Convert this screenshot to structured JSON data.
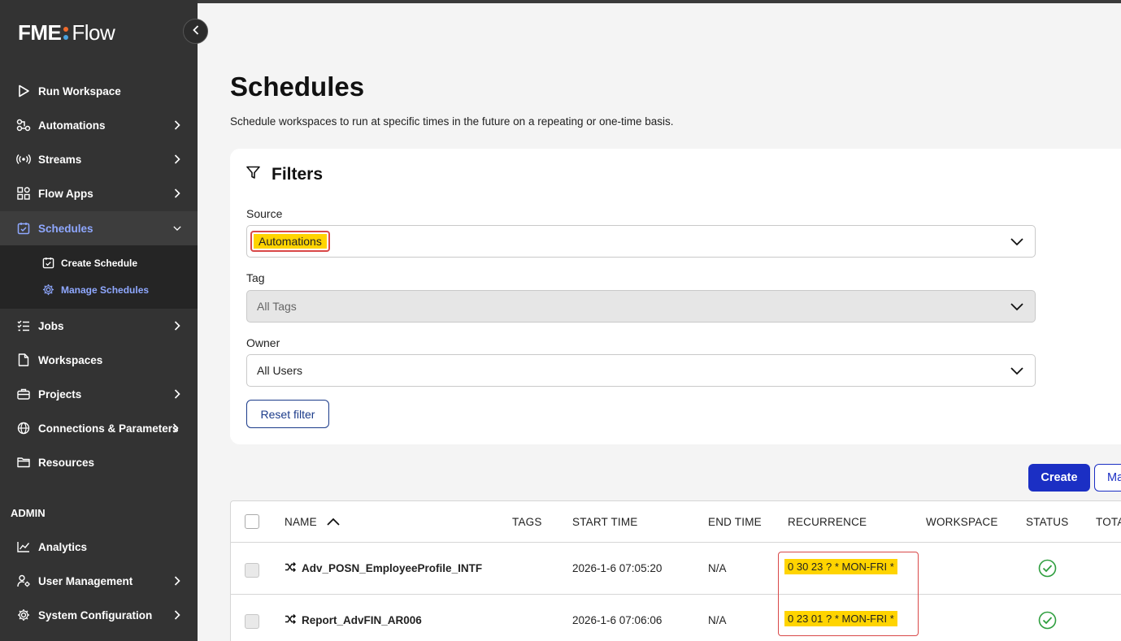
{
  "app": {
    "logo_fme": "FME",
    "logo_flow": "Flow"
  },
  "sidebar": {
    "items": [
      {
        "label": "Run Workspace",
        "icon": "play-icon",
        "has_submenu": false
      },
      {
        "label": "Automations",
        "icon": "automations-icon",
        "has_submenu": true
      },
      {
        "label": "Streams",
        "icon": "broadcast-icon",
        "has_submenu": true
      },
      {
        "label": "Flow Apps",
        "icon": "apps-grid-icon",
        "has_submenu": true
      },
      {
        "label": "Schedules",
        "icon": "calendar-check-icon",
        "has_submenu": true,
        "expanded": true,
        "active": true
      },
      {
        "label": "Jobs",
        "icon": "list-check-icon",
        "has_submenu": true
      },
      {
        "label": "Workspaces",
        "icon": "document-icon",
        "has_submenu": false
      },
      {
        "label": "Projects",
        "icon": "briefcase-icon",
        "has_submenu": true
      },
      {
        "label": "Connections & Parameters",
        "icon": "globe-icon",
        "has_submenu": true
      },
      {
        "label": "Resources",
        "icon": "folder-icon",
        "has_submenu": false
      }
    ],
    "schedules_sub": [
      {
        "label": "Create Schedule",
        "icon": "calendar-check-icon"
      },
      {
        "label": "Manage Schedules",
        "icon": "gear-icon",
        "active": true
      }
    ],
    "admin_label": "ADMIN",
    "admin_items": [
      {
        "label": "Analytics",
        "icon": "chart-line-icon",
        "has_submenu": false
      },
      {
        "label": "User Management",
        "icon": "user-gear-icon",
        "has_submenu": true
      },
      {
        "label": "System Configuration",
        "icon": "gear-icon",
        "has_submenu": true
      }
    ]
  },
  "page": {
    "title": "Schedules",
    "subtitle": "Schedule workspaces to run at specific times in the future on a repeating or one-time basis."
  },
  "filters": {
    "title": "Filters",
    "source_label": "Source",
    "source_value": "Automations",
    "tag_label": "Tag",
    "tag_value": "All Tags",
    "owner_label": "Owner",
    "owner_value": "All Users",
    "reset_label": "Reset filter"
  },
  "actions": {
    "create_label": "Create",
    "more_label": "Ma"
  },
  "table": {
    "columns": [
      "NAME",
      "TAGS",
      "START TIME",
      "END TIME",
      "RECURRENCE",
      "WORKSPACE",
      "STATUS",
      "TOTA"
    ],
    "sort_column": "NAME",
    "sort_direction": "ascending",
    "rows": [
      {
        "name": "Adv_POSN_EmployeeProfile_INTF",
        "tags": "",
        "start_time": "2026-1-6 07:05:20",
        "end_time": "N/A",
        "recurrence": "0 30 23 ? * MON-FRI *",
        "workspace": "",
        "status": "enabled"
      },
      {
        "name": "Report_AdvFIN_AR006",
        "tags": "",
        "start_time": "2026-1-6 07:06:06",
        "end_time": "N/A",
        "recurrence": "0 23 01 ? * MON-FRI *",
        "workspace": "",
        "status": "enabled"
      }
    ]
  },
  "colors": {
    "sidebar_bg": "#333333",
    "accent": "#1b2fc4",
    "active_nav": "#8fa8ff",
    "highlight": "#ffd400",
    "annotation_red": "#d94848",
    "status_green": "#2e9e3e"
  }
}
